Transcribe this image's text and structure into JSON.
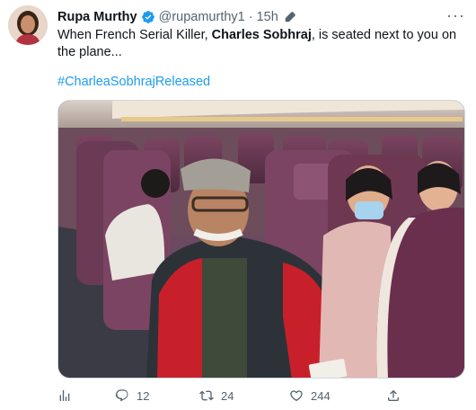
{
  "tweet": {
    "author_name": "Rupa Murthy",
    "handle": "@rupamurthy1",
    "time": "15h",
    "text_pre": "When French Serial Killer, ",
    "text_bold": "Charles Sobhraj",
    "text_post": ", is seated next to you on the plane...",
    "hashtag": "#CharleaSobhrajReleased"
  },
  "actions": {
    "replies": "12",
    "retweets": "24",
    "likes": "244"
  },
  "colors": {
    "link": "#1d9bf0",
    "secondary_text": "#536471",
    "verified_badge": "#1d9bf0"
  },
  "icons": [
    "verified-badge-icon",
    "edit-pen-icon",
    "more-icon",
    "analytics-icon",
    "reply-icon",
    "retweet-icon",
    "like-icon",
    "share-icon"
  ]
}
